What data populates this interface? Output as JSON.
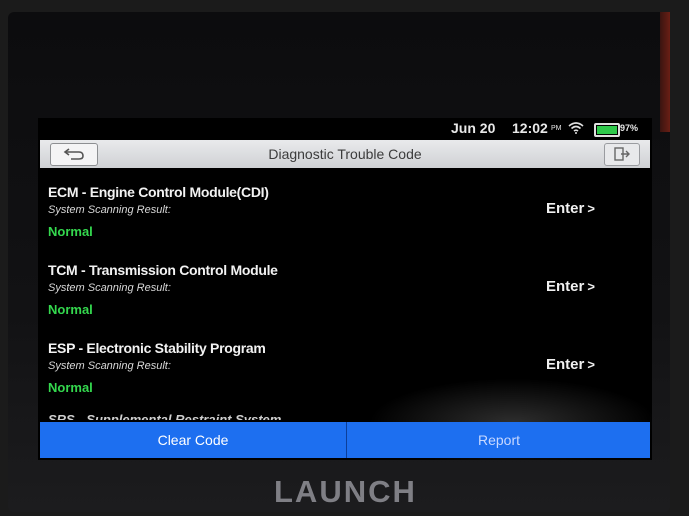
{
  "status_bar": {
    "date": "Jun 20",
    "time": "12:02",
    "ampm": "PM",
    "battery": "97%"
  },
  "title_bar": {
    "title": "Diagnostic Trouble Code"
  },
  "systems": [
    {
      "name": "ECM - Engine Control Module(CDI)",
      "subtitle": "System Scanning Result:",
      "status": "Normal",
      "action": "Enter"
    },
    {
      "name": "TCM - Transmission Control Module",
      "subtitle": "System Scanning Result:",
      "status": "Normal",
      "action": "Enter"
    },
    {
      "name": "ESP - Electronic Stability Program",
      "subtitle": "System Scanning Result:",
      "status": "Normal",
      "action": "Enter"
    },
    {
      "name": "SRS - Supplemental Restraint System"
    }
  ],
  "footer": {
    "clear_label": "Clear Code",
    "report_label": "Report"
  },
  "brand": "LAUNCH",
  "colors": {
    "accent": "#1d6ff0",
    "normal": "#34d84e",
    "title_bar": "#dcdde0"
  }
}
